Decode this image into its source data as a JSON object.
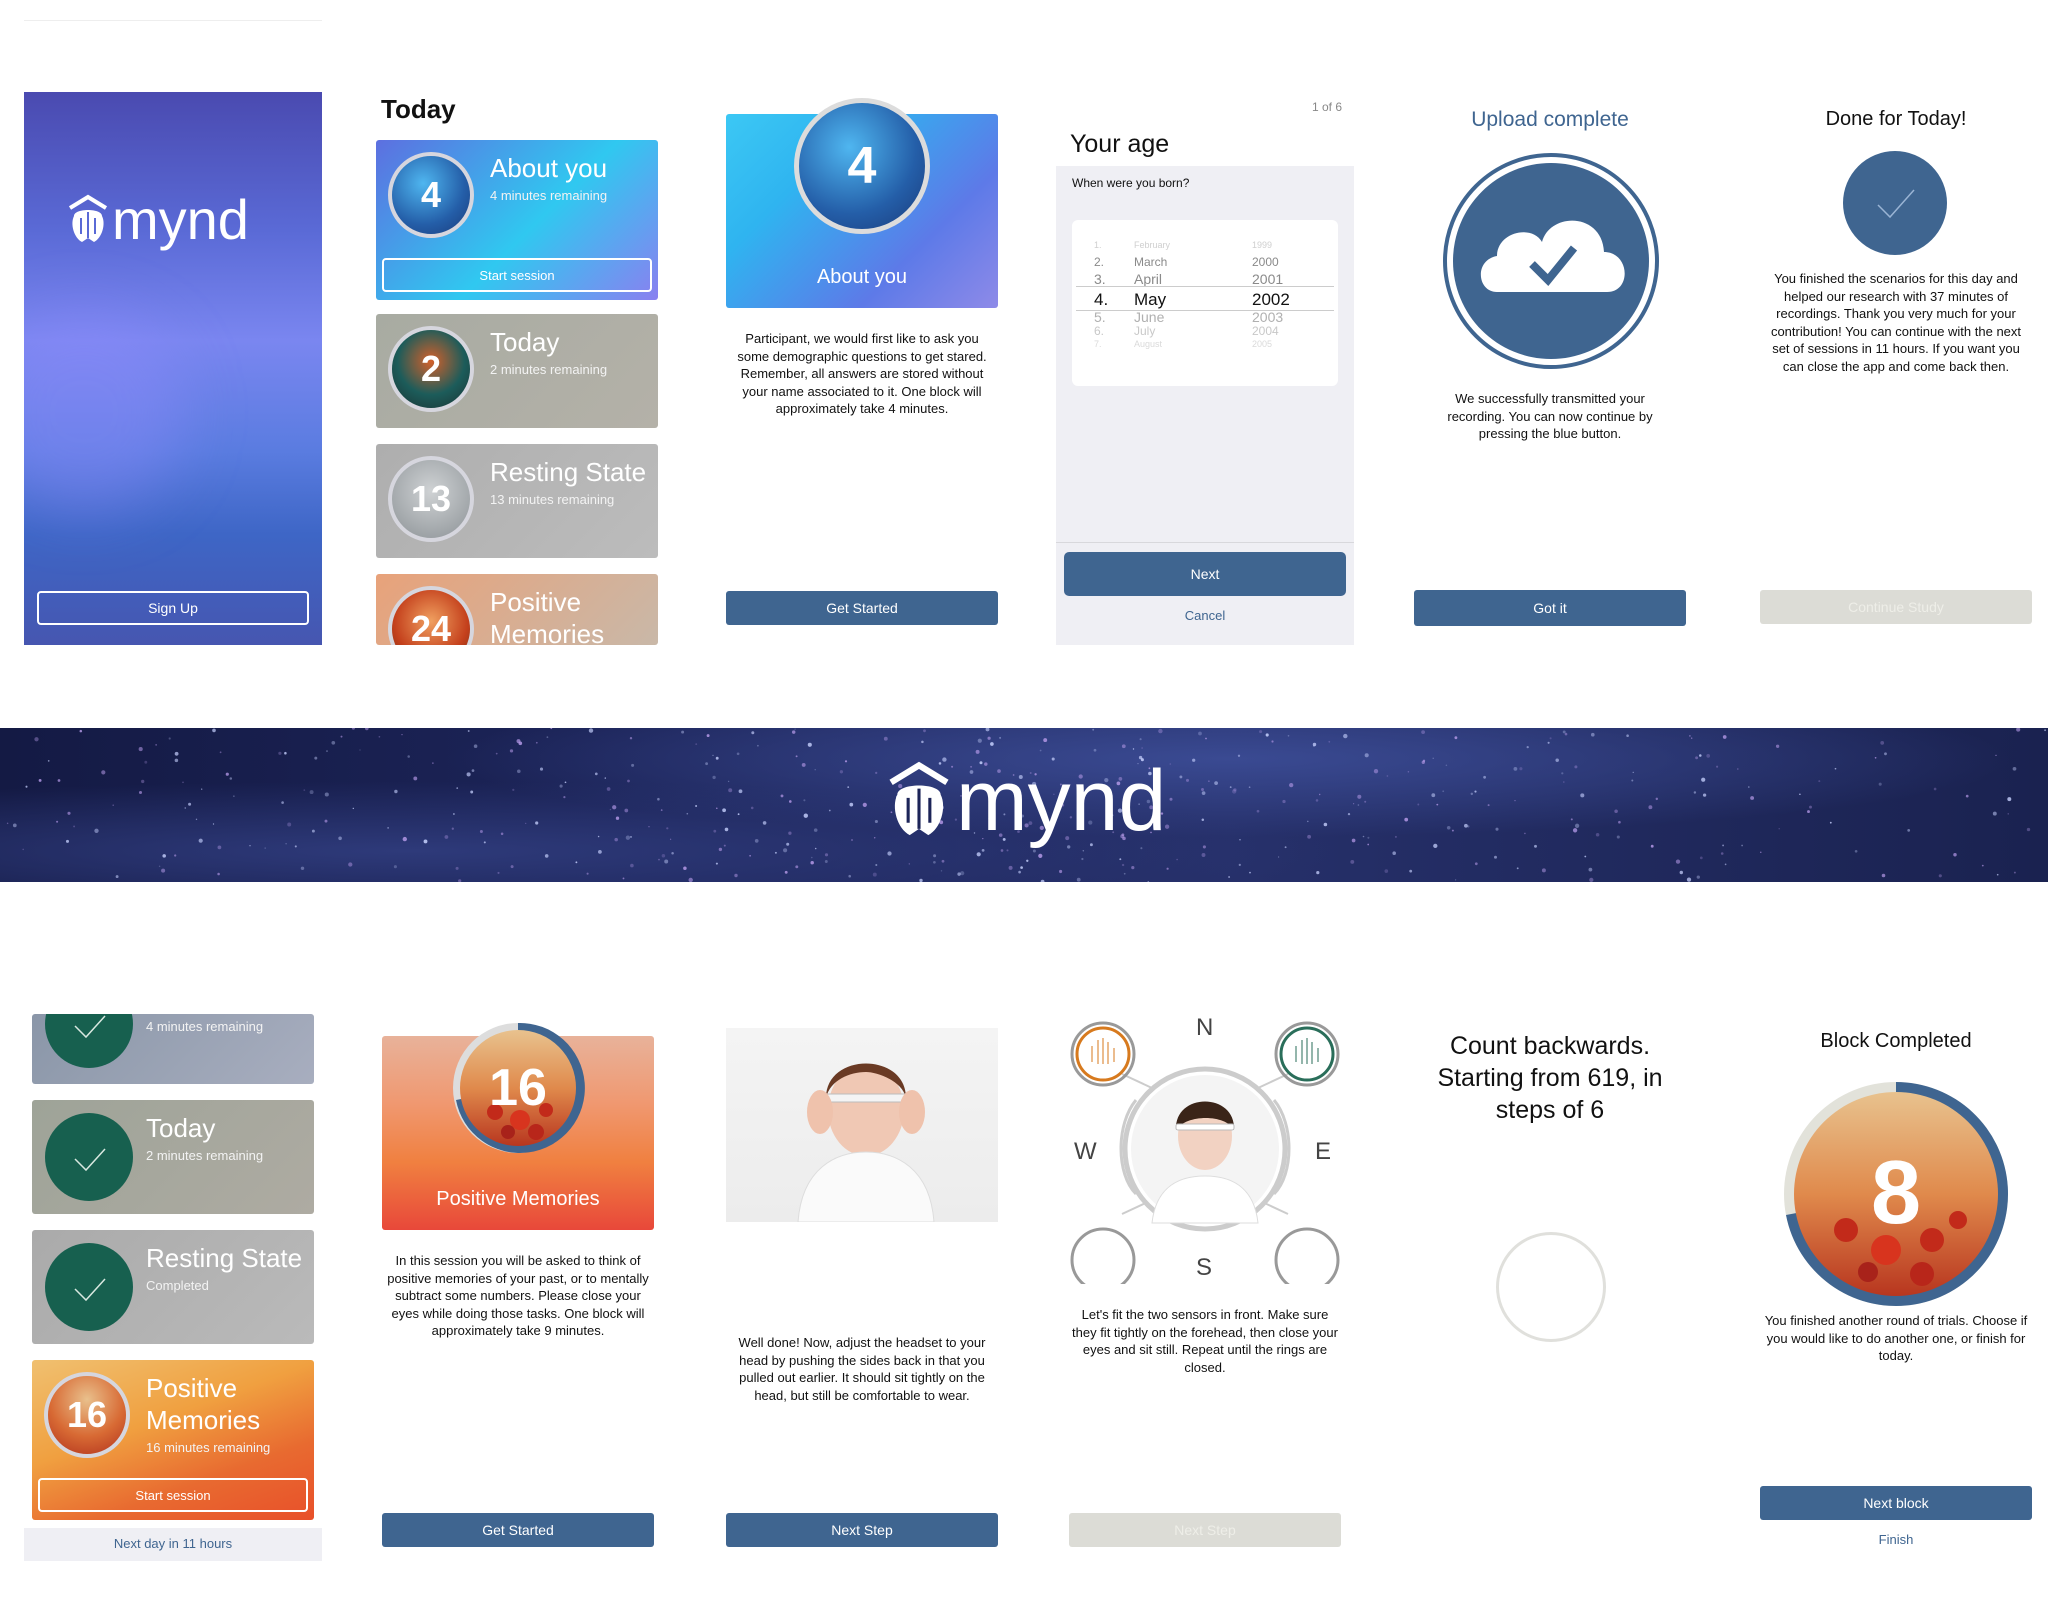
{
  "splash": {
    "brand": "mynd",
    "signup": "Sign Up"
  },
  "home": {
    "title": "Today",
    "cards": [
      {
        "number": "4",
        "title": "About you",
        "sub": "4 minutes remaining",
        "action": "Start session"
      },
      {
        "number": "2",
        "title": "Today",
        "sub": "2 minutes remaining"
      },
      {
        "number": "13",
        "title": "Resting State",
        "sub": "13 minutes remaining"
      },
      {
        "number": "24",
        "title": "Positive\nMemories"
      }
    ]
  },
  "about": {
    "number": "4",
    "title": "About you",
    "text": "Participant, we would first like to ask you some demographic questions to get stared. Remember, all answers are stored without your name associated to it. One block will approximately take 4 minutes.",
    "button": "Get Started"
  },
  "age": {
    "counter": "1 of 6",
    "title": "Your age",
    "question": "When were you born?",
    "picker": [
      {
        "n": "1.",
        "m": "February",
        "y": "1999"
      },
      {
        "n": "2.",
        "m": "March",
        "y": "2000"
      },
      {
        "n": "3.",
        "m": "April",
        "y": "2001"
      },
      {
        "n": "4.",
        "m": "May",
        "y": "2002"
      },
      {
        "n": "5.",
        "m": "June",
        "y": "2003"
      },
      {
        "n": "6.",
        "m": "July",
        "y": "2004"
      },
      {
        "n": "7.",
        "m": "August",
        "y": "2005"
      }
    ],
    "next": "Next",
    "cancel": "Cancel"
  },
  "upload": {
    "title": "Upload complete",
    "text": "We successfully transmitted your recording. You can now continue by pressing the blue button.",
    "button": "Got it"
  },
  "done": {
    "title": "Done for Today!",
    "text": "You finished the scenarios for this day and helped our research with 37 minutes of recordings. Thank you very much for your contribution! You can continue with the next set of sessions in 11 hours. If you want you can close the app and come back then.",
    "button": "Continue Study"
  },
  "banner": {
    "brand": "mynd"
  },
  "home2": {
    "cards": [
      {
        "title": "",
        "sub": "4 minutes remaining"
      },
      {
        "title": "Today",
        "sub": "2 minutes remaining"
      },
      {
        "title": "Resting State",
        "sub": "Completed"
      },
      {
        "number": "16",
        "title": "Positive\nMemories",
        "sub": "16 minutes remaining",
        "action": "Start session"
      }
    ],
    "footer": "Next day in 11 hours"
  },
  "positive": {
    "number": "16",
    "title": "Positive Memories",
    "text": "In this session you will be asked to think of positive memories of your past, or to mentally subtract some numbers. Please close your eyes while doing those tasks. One block will approximately take 9 minutes.",
    "button": "Get Started"
  },
  "headset": {
    "text": "Well done! Now, adjust the headset to your head by pushing the sides back in that you pulled out earlier. It should sit tightly on the head, but still be comfortable to wear.",
    "button": "Next Step"
  },
  "sensors": {
    "n": "N",
    "e": "E",
    "s": "S",
    "w": "W",
    "text": "Let's fit the two sensors in front. Make sure they fit tightly on the forehead, then close your eyes and sit still. Repeat until the rings are closed.",
    "button": "Next Step"
  },
  "count": {
    "title": "Count backwards. Starting from 619, in steps of 6"
  },
  "block": {
    "title": "Block Completed",
    "number": "8",
    "progress": 0.72,
    "text": "You finished another round of trials. Choose if you would like to do another one, or finish for today.",
    "button": "Next block",
    "finish": "Finish"
  }
}
